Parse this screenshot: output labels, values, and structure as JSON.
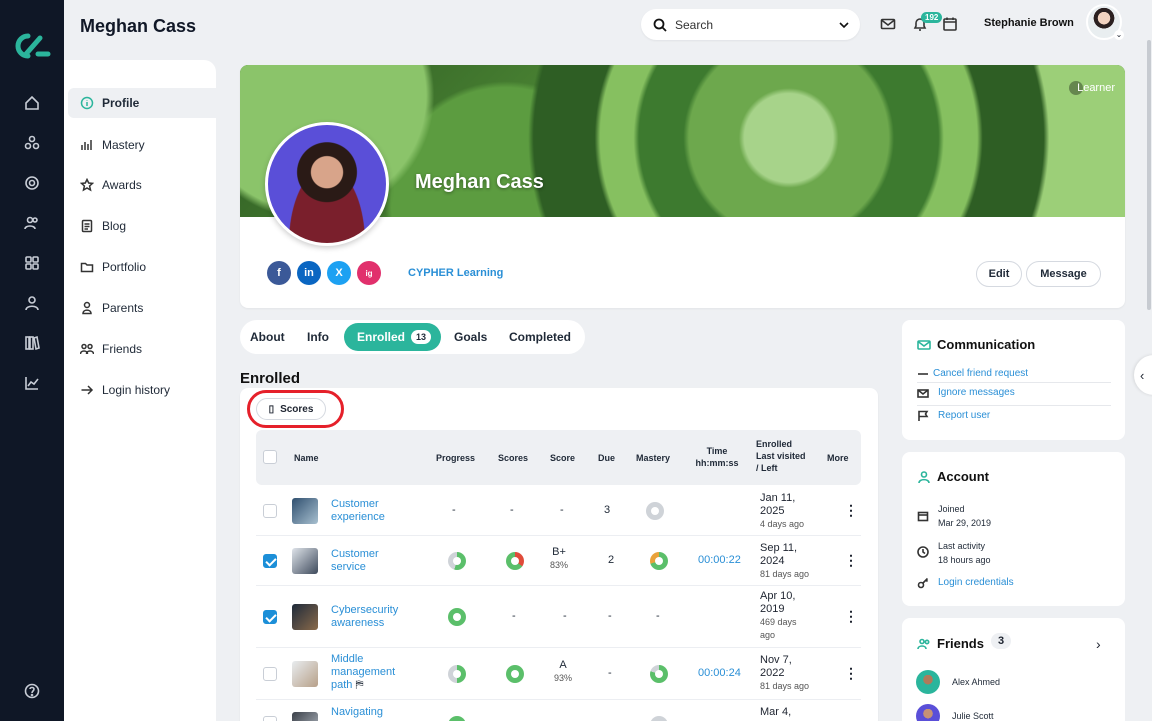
{
  "header": {
    "page_title": "Meghan Cass",
    "search_placeholder": "Search",
    "notifications_count": "192",
    "user_name": "Stephanie Brown"
  },
  "rail_icons": [
    "home-icon",
    "network-icon",
    "target-icon",
    "people-icon",
    "grid-icon",
    "person-icon",
    "library-icon",
    "chart-icon",
    "help-icon"
  ],
  "leftnav": {
    "items": [
      {
        "label": "Profile",
        "icon": "info-icon"
      },
      {
        "label": "Mastery",
        "icon": "bar-chart-icon"
      },
      {
        "label": "Awards",
        "icon": "star-icon"
      },
      {
        "label": "Blog",
        "icon": "document-icon"
      },
      {
        "label": "Portfolio",
        "icon": "folder-icon"
      },
      {
        "label": "Parents",
        "icon": "parent-icon"
      },
      {
        "label": "Friends",
        "icon": "friends-icon"
      },
      {
        "label": "Login history",
        "icon": "login-arrow-icon"
      }
    ]
  },
  "profile": {
    "name": "Meghan Cass",
    "role": "Learner",
    "organization": "CYPHER Learning",
    "edit_label": "Edit",
    "message_label": "Message",
    "social": [
      "f",
      "in",
      "X",
      "ig"
    ]
  },
  "tabs": {
    "about": "About",
    "info": "Info",
    "enrolled": "Enrolled",
    "enrolled_count": "13",
    "goals": "Goals",
    "completed": "Completed"
  },
  "enrolled": {
    "title": "Enrolled",
    "scores_button": "Scores",
    "columns": {
      "name": "Name",
      "progress": "Progress",
      "scores": "Scores",
      "score": "Score",
      "due": "Due",
      "mastery": "Mastery",
      "time_1": "Time",
      "time_2": "hh:mm:ss",
      "enrolled_1": "Enrolled",
      "enrolled_2": "Last visited",
      "enrolled_3": "/ Left",
      "more": "More"
    },
    "rows": [
      {
        "name_1": "Customer",
        "name_2": "experience",
        "progress": "-",
        "scores": "-",
        "score": "-",
        "score_pct": "",
        "due": "3",
        "time": "",
        "date_1": "Jan 11,",
        "date_2": "2025",
        "date_3": "4 days ago",
        "date_4": ""
      },
      {
        "name_1": "Customer",
        "name_2": "service",
        "progress": "",
        "scores": "",
        "score": "B+",
        "score_pct": "83%",
        "due": "2",
        "time": "00:00:22",
        "date_1": "Sep 11,",
        "date_2": "2024",
        "date_3": "81 days ago",
        "date_4": ""
      },
      {
        "name_1": "Cybersecurity",
        "name_2": "awareness",
        "progress": "",
        "scores": "-",
        "score": "-",
        "score_pct": "",
        "due": "-",
        "time": "",
        "date_1": "Apr 10,",
        "date_2": "2019",
        "date_3": "469 days",
        "date_4": "ago"
      },
      {
        "name_1": "Middle",
        "name_2": "management",
        "name_3": "path",
        "progress": "",
        "scores": "",
        "score": "A",
        "score_pct": "93%",
        "due": "-",
        "time": "00:00:24",
        "date_1": "Nov 7,",
        "date_2": "2022",
        "date_3": "81 days ago",
        "date_4": ""
      },
      {
        "name_1": "Navigating",
        "progress": "",
        "scores": "",
        "score": "",
        "score_pct": "",
        "due": "",
        "time": "",
        "date_1": "Mar 4,",
        "date_2": "",
        "date_3": "",
        "date_4": ""
      }
    ]
  },
  "communication": {
    "title": "Communication",
    "cancel_friend": "Cancel friend request",
    "ignore": "Ignore messages",
    "report": "Report user"
  },
  "account": {
    "title": "Account",
    "joined_label": "Joined",
    "joined_date": "Mar 29, 2019",
    "last_activity_label": "Last activity",
    "last_activity_value": "18 hours ago",
    "login_credentials": "Login credentials"
  },
  "friends": {
    "title": "Friends",
    "count": "3",
    "list": [
      "Alex Ahmed",
      "Julie Scott"
    ]
  },
  "colors": {
    "accent": "#2bb59c",
    "link": "#2a8fd6",
    "rail": "#0f1726",
    "highlight_ring": "#e5202a"
  }
}
